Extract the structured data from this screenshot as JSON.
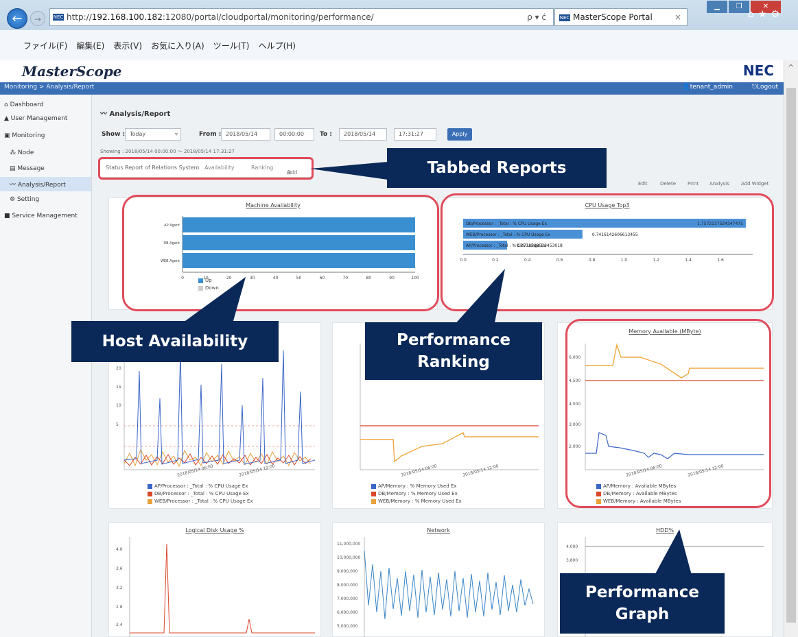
{
  "browser": {
    "url_prefix": "http://",
    "url_host": "192.168.100.182",
    "url_rest": ":12080/portal/cloudportal/monitoring/performance/",
    "url_actions": "ρ ▾ ċ",
    "tab_title": "MasterScope Portal",
    "tab_close": "×",
    "favicon": "NEC",
    "menu": [
      "ファイル(F)",
      "編集(E)",
      "表示(V)",
      "お気に入り(A)",
      "ツール(T)",
      "ヘルプ(H)"
    ]
  },
  "app": {
    "logo": "MasterScope",
    "brand": "NEC",
    "breadcrumb": "Monitoring > Analysis/Report",
    "user": "tenant_admin",
    "logout": "Logout",
    "colors": {
      "nav": "#3a6fb5",
      "callout": "#0b2958",
      "highlight": "#e14b5a"
    }
  },
  "sidebar": {
    "items": [
      {
        "label": "Dashboard",
        "icon": "home-icon"
      },
      {
        "label": "User Management",
        "icon": "user-icon"
      },
      {
        "label": "Monitoring",
        "icon": "monitor-icon"
      },
      {
        "label": "Node",
        "icon": "node-icon"
      },
      {
        "label": "Message",
        "icon": "message-icon"
      },
      {
        "label": "Analysis/Report",
        "icon": "chart-icon"
      },
      {
        "label": "Setting",
        "icon": "setting-icon"
      },
      {
        "label": "Service Management",
        "icon": "service-icon"
      }
    ]
  },
  "report": {
    "title": "Analysis/Report",
    "show_label": "Show :",
    "show_value": "Today",
    "from_label": "From :",
    "from_date": "2018/05/14",
    "from_time": "00:00:00",
    "to_label": "To :",
    "to_date": "2018/05/14",
    "to_time": "17:31:27",
    "apply": "Apply",
    "showing": "Showing : 2018/05/14 00:00:00 ～ 2018/05/14 17:31:27",
    "tabs": [
      "Status Report of Relations System",
      "Availability",
      "Ranking",
      "Add"
    ],
    "toolbar": [
      "Edit",
      "Delete",
      "Print",
      "Analysis",
      "Add Widget"
    ]
  },
  "callouts": {
    "tabbed": "Tabbed Reports",
    "host": "Host Availability",
    "ranking_line1": "Performance",
    "ranking_line2": "Ranking",
    "graph_line1": "Performance",
    "graph_line2": "Graph"
  },
  "panels": {
    "availability": {
      "title": "Machine Availability",
      "legend": [
        "Up",
        "Down"
      ]
    },
    "cpu_top": {
      "title": "CPU Usage Top3",
      "bars": [
        {
          "label": "DB/Processor : _Total : % CPU Usage Ex",
          "value_text": "1.7572117524347475"
        },
        {
          "label": "WEB/Processor : _Total : % CPU Usage Ex",
          "value_text": "0.7416142606613455"
        },
        {
          "label": "AP/Processor : _Total : % CPU Usage Ex",
          "value_text": "0.2731708533453018"
        }
      ]
    },
    "cpu_graph": {
      "legend": [
        "AP/Processor : _Total : % CPU Usage Ex",
        "DB/Processor : _Total : % CPU Usage Ex",
        "WEB/Processor : _Total : % CPU Usage Ex"
      ],
      "xticks": [
        "2018/05/14 06:00",
        "2018/05/14 12:00"
      ]
    },
    "memory_used": {
      "legend": [
        "AP/Memory : % Memory Used Ex",
        "DB/Memory : % Memory Used Ex",
        "WEB/Memory : % Memory Used Ex"
      ],
      "xticks": [
        "2018/05/14 06:00",
        "2018/05/14 12:00"
      ]
    },
    "memory_avail": {
      "title": "Memory Available (MByte)",
      "legend": [
        "AP/Memory : Available MBytes",
        "DB/Memory : Available MBytes",
        "WEB/Memory : Available MBytes"
      ],
      "xticks": [
        "2018/05/14 06:00",
        "2018/05/14 12:00"
      ]
    },
    "disk": {
      "title": "Logical Disk Usage %"
    },
    "network": {
      "title": "Network"
    },
    "third": {
      "title": "HDD%"
    }
  },
  "chart_data": [
    {
      "type": "bar",
      "title": "Machine Availability",
      "categories": [
        "AP Agent",
        "DB Agent",
        "WEB Agent"
      ],
      "series": [
        {
          "name": "Up",
          "values": [
            100,
            100,
            100
          ]
        },
        {
          "name": "Down",
          "values": [
            0,
            0,
            0
          ]
        }
      ],
      "xlim": [
        0,
        100
      ],
      "xticks": [
        0,
        10,
        20,
        30,
        40,
        50,
        60,
        70,
        80,
        90,
        100
      ]
    },
    {
      "type": "bar",
      "title": "CPU Usage Top3",
      "categories": [
        "DB/Processor : _Total : % CPU Usage Ex",
        "WEB/Processor : _Total : % CPU Usage Ex",
        "AP/Processor : _Total : % CPU Usage Ex"
      ],
      "values": [
        1.7572117524347475,
        0.7416142606613455,
        0.2731708533453018
      ],
      "xlim": [
        0,
        1.8
      ],
      "xticks": [
        "0.0",
        "0.2",
        "0.4",
        "0.6",
        "0.8",
        "1.0",
        "1.2",
        "1.4",
        "1.6"
      ]
    }
  ]
}
